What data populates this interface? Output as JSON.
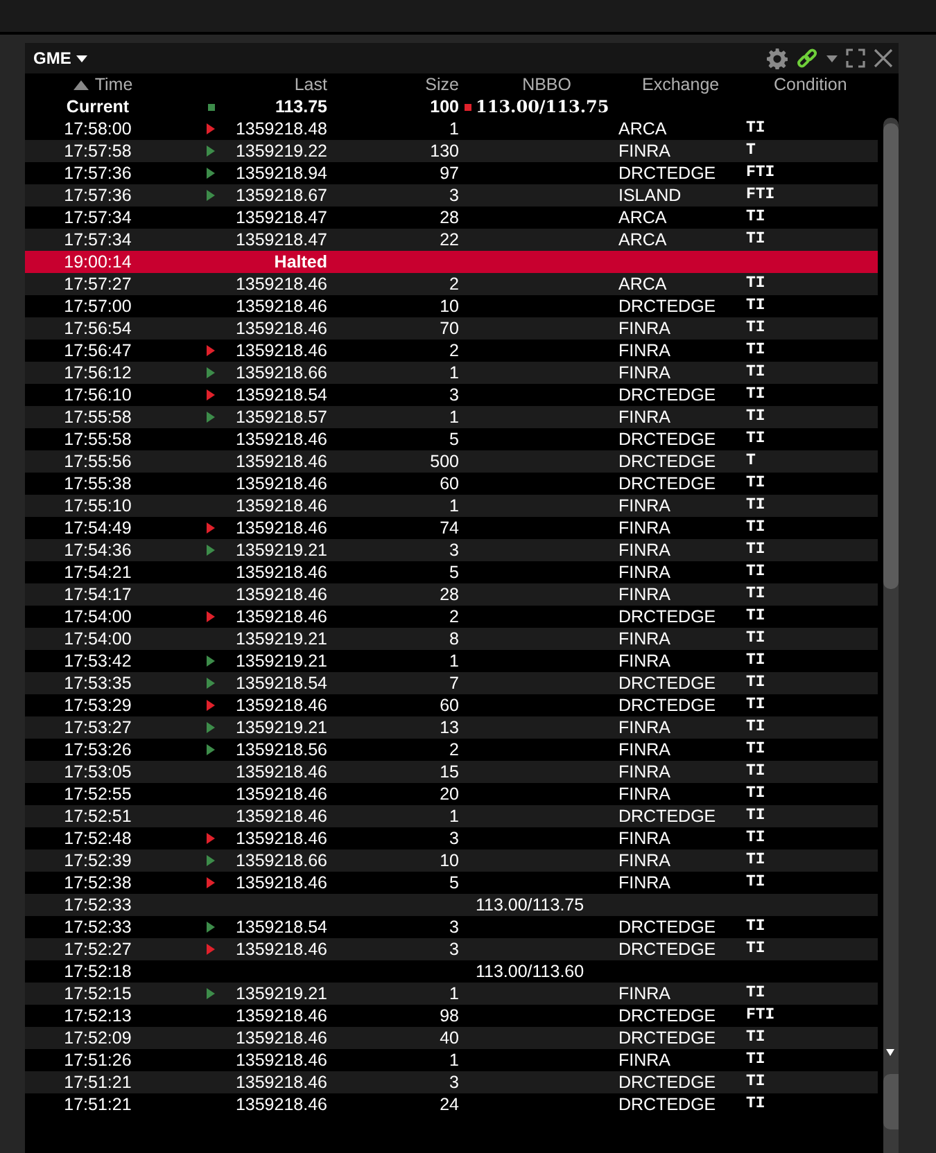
{
  "window": {
    "symbol": "GME"
  },
  "columns": [
    "Time",
    "Last",
    "Size",
    "NBBO",
    "Exchange",
    "Condition"
  ],
  "current": {
    "label": "Current",
    "last_marker": {
      "color": "#3d8c4a"
    },
    "last": "113.75",
    "size": "100",
    "nbbo_marker": {
      "color": "#e0212b"
    },
    "nbbo": "113.00/113.75"
  },
  "rows": [
    {
      "kind": "trade",
      "time": "17:58:00",
      "marker": {
        "color": "#e0212b"
      },
      "last": "1359218.48",
      "size": "1",
      "exchange": "ARCA",
      "condition": "TI"
    },
    {
      "kind": "trade",
      "time": "17:57:58",
      "marker": {
        "color": "#3d8c4a"
      },
      "last": "1359219.22",
      "size": "130",
      "exchange": "FINRA",
      "condition": "T"
    },
    {
      "kind": "trade",
      "time": "17:57:36",
      "marker": {
        "color": "#3d8c4a"
      },
      "last": "1359218.94",
      "size": "97",
      "exchange": "DRCTEDGE",
      "condition": "FTI"
    },
    {
      "kind": "trade",
      "time": "17:57:36",
      "marker": {
        "color": "#3d8c4a"
      },
      "last": "1359218.67",
      "size": "3",
      "exchange": "ISLAND",
      "condition": "FTI"
    },
    {
      "kind": "trade",
      "time": "17:57:34",
      "last": "1359218.47",
      "size": "28",
      "exchange": "ARCA",
      "condition": "TI"
    },
    {
      "kind": "trade",
      "time": "17:57:34",
      "last": "1359218.47",
      "size": "22",
      "exchange": "ARCA",
      "condition": "TI"
    },
    {
      "kind": "halt",
      "time": "19:00:14",
      "status": "Halted"
    },
    {
      "kind": "trade",
      "time": "17:57:27",
      "last": "1359218.46",
      "size": "2",
      "exchange": "ARCA",
      "condition": "TI"
    },
    {
      "kind": "trade",
      "time": "17:57:00",
      "last": "1359218.46",
      "size": "10",
      "exchange": "DRCTEDGE",
      "condition": "TI"
    },
    {
      "kind": "trade",
      "time": "17:56:54",
      "last": "1359218.46",
      "size": "70",
      "exchange": "FINRA",
      "condition": "TI"
    },
    {
      "kind": "trade",
      "time": "17:56:47",
      "marker": {
        "color": "#e0212b"
      },
      "last": "1359218.46",
      "size": "2",
      "exchange": "FINRA",
      "condition": "TI"
    },
    {
      "kind": "trade",
      "time": "17:56:12",
      "marker": {
        "color": "#3d8c4a"
      },
      "last": "1359218.66",
      "size": "1",
      "exchange": "FINRA",
      "condition": "TI"
    },
    {
      "kind": "trade",
      "time": "17:56:10",
      "marker": {
        "color": "#e0212b"
      },
      "last": "1359218.54",
      "size": "3",
      "exchange": "DRCTEDGE",
      "condition": "TI"
    },
    {
      "kind": "trade",
      "time": "17:55:58",
      "marker": {
        "color": "#3d8c4a"
      },
      "last": "1359218.57",
      "size": "1",
      "exchange": "FINRA",
      "condition": "TI"
    },
    {
      "kind": "trade",
      "time": "17:55:58",
      "last": "1359218.46",
      "size": "5",
      "exchange": "DRCTEDGE",
      "condition": "TI"
    },
    {
      "kind": "trade",
      "time": "17:55:56",
      "last": "1359218.46",
      "size": "500",
      "exchange": "DRCTEDGE",
      "condition": "T"
    },
    {
      "kind": "trade",
      "time": "17:55:38",
      "last": "1359218.46",
      "size": "60",
      "exchange": "DRCTEDGE",
      "condition": "TI"
    },
    {
      "kind": "trade",
      "time": "17:55:10",
      "last": "1359218.46",
      "size": "1",
      "exchange": "FINRA",
      "condition": "TI"
    },
    {
      "kind": "trade",
      "time": "17:54:49",
      "marker": {
        "color": "#e0212b"
      },
      "last": "1359218.46",
      "size": "74",
      "exchange": "FINRA",
      "condition": "TI"
    },
    {
      "kind": "trade",
      "time": "17:54:36",
      "marker": {
        "color": "#3d8c4a"
      },
      "last": "1359219.21",
      "size": "3",
      "exchange": "FINRA",
      "condition": "TI"
    },
    {
      "kind": "trade",
      "time": "17:54:21",
      "last": "1359218.46",
      "size": "5",
      "exchange": "FINRA",
      "condition": "TI"
    },
    {
      "kind": "trade",
      "time": "17:54:17",
      "last": "1359218.46",
      "size": "28",
      "exchange": "FINRA",
      "condition": "TI"
    },
    {
      "kind": "trade",
      "time": "17:54:00",
      "marker": {
        "color": "#e0212b"
      },
      "last": "1359218.46",
      "size": "2",
      "exchange": "DRCTEDGE",
      "condition": "TI"
    },
    {
      "kind": "trade",
      "time": "17:54:00",
      "last": "1359219.21",
      "size": "8",
      "exchange": "FINRA",
      "condition": "TI"
    },
    {
      "kind": "trade",
      "time": "17:53:42",
      "marker": {
        "color": "#3d8c4a"
      },
      "last": "1359219.21",
      "size": "1",
      "exchange": "FINRA",
      "condition": "TI"
    },
    {
      "kind": "trade",
      "time": "17:53:35",
      "marker": {
        "color": "#3d8c4a"
      },
      "last": "1359218.54",
      "size": "7",
      "exchange": "DRCTEDGE",
      "condition": "TI"
    },
    {
      "kind": "trade",
      "time": "17:53:29",
      "marker": {
        "color": "#e0212b"
      },
      "last": "1359218.46",
      "size": "60",
      "exchange": "DRCTEDGE",
      "condition": "TI"
    },
    {
      "kind": "trade",
      "time": "17:53:27",
      "marker": {
        "color": "#3d8c4a"
      },
      "last": "1359219.21",
      "size": "13",
      "exchange": "FINRA",
      "condition": "TI"
    },
    {
      "kind": "trade",
      "time": "17:53:26",
      "marker": {
        "color": "#3d8c4a"
      },
      "last": "1359218.56",
      "size": "2",
      "exchange": "FINRA",
      "condition": "TI"
    },
    {
      "kind": "trade",
      "time": "17:53:05",
      "last": "1359218.46",
      "size": "15",
      "exchange": "FINRA",
      "condition": "TI"
    },
    {
      "kind": "trade",
      "time": "17:52:55",
      "last": "1359218.46",
      "size": "20",
      "exchange": "FINRA",
      "condition": "TI"
    },
    {
      "kind": "trade",
      "time": "17:52:51",
      "last": "1359218.46",
      "size": "1",
      "exchange": "DRCTEDGE",
      "condition": "TI"
    },
    {
      "kind": "trade",
      "time": "17:52:48",
      "marker": {
        "color": "#e0212b"
      },
      "last": "1359218.46",
      "size": "3",
      "exchange": "FINRA",
      "condition": "TI"
    },
    {
      "kind": "trade",
      "time": "17:52:39",
      "marker": {
        "color": "#3d8c4a"
      },
      "last": "1359218.66",
      "size": "10",
      "exchange": "FINRA",
      "condition": "TI"
    },
    {
      "kind": "trade",
      "time": "17:52:38",
      "marker": {
        "color": "#e0212b"
      },
      "last": "1359218.46",
      "size": "5",
      "exchange": "FINRA",
      "condition": "TI"
    },
    {
      "kind": "quote",
      "time": "17:52:33",
      "nbbo": "113.00/113.75"
    },
    {
      "kind": "trade",
      "time": "17:52:33",
      "marker": {
        "color": "#3d8c4a"
      },
      "last": "1359218.54",
      "size": "3",
      "exchange": "DRCTEDGE",
      "condition": "TI"
    },
    {
      "kind": "trade",
      "time": "17:52:27",
      "marker": {
        "color": "#e0212b"
      },
      "last": "1359218.46",
      "size": "3",
      "exchange": "DRCTEDGE",
      "condition": "TI"
    },
    {
      "kind": "quote",
      "time": "17:52:18",
      "nbbo": "113.00/113.60"
    },
    {
      "kind": "trade",
      "time": "17:52:15",
      "marker": {
        "color": "#3d8c4a"
      },
      "last": "1359219.21",
      "size": "1",
      "exchange": "FINRA",
      "condition": "TI"
    },
    {
      "kind": "trade",
      "time": "17:52:13",
      "last": "1359218.46",
      "size": "98",
      "exchange": "DRCTEDGE",
      "condition": "FTI"
    },
    {
      "kind": "trade",
      "time": "17:52:09",
      "last": "1359218.46",
      "size": "40",
      "exchange": "DRCTEDGE",
      "condition": "TI"
    },
    {
      "kind": "trade",
      "time": "17:51:26",
      "last": "1359218.46",
      "size": "1",
      "exchange": "FINRA",
      "condition": "TI"
    },
    {
      "kind": "trade",
      "time": "17:51:21",
      "last": "1359218.46",
      "size": "3",
      "exchange": "DRCTEDGE",
      "condition": "TI"
    },
    {
      "kind": "trade",
      "time": "17:51:21",
      "last": "1359218.46",
      "size": "24",
      "exchange": "DRCTEDGE",
      "condition": "TI"
    }
  ]
}
